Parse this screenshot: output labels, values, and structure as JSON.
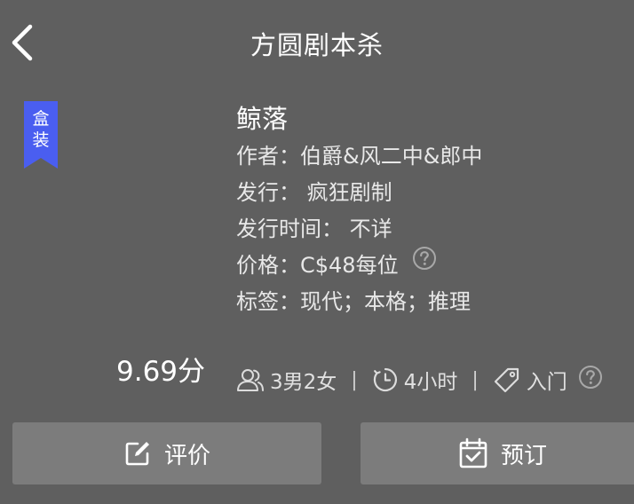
{
  "header": {
    "title": "方圆剧本杀",
    "back_icon": "chevron-left-icon"
  },
  "badge": {
    "text": "盒\n装",
    "color": "#4a5ef0"
  },
  "game": {
    "title": "鲸落",
    "author_label": "作者：",
    "author_value": "伯爵&风二中&郎中",
    "publisher_label": "发行：",
    "publisher_value": "疯狂剧制",
    "release_label": "发行时间：",
    "release_value": "不详",
    "price_label": "价格：",
    "price_value": "C$48每位",
    "tags_label": "标签：",
    "tags_value": "现代；本格；推理",
    "score": "9.69分"
  },
  "meta": {
    "players": "3男2女",
    "duration": "4小时",
    "difficulty": "入门",
    "separator": "|"
  },
  "actions": {
    "review_label": "评价",
    "book_label": "预订"
  }
}
